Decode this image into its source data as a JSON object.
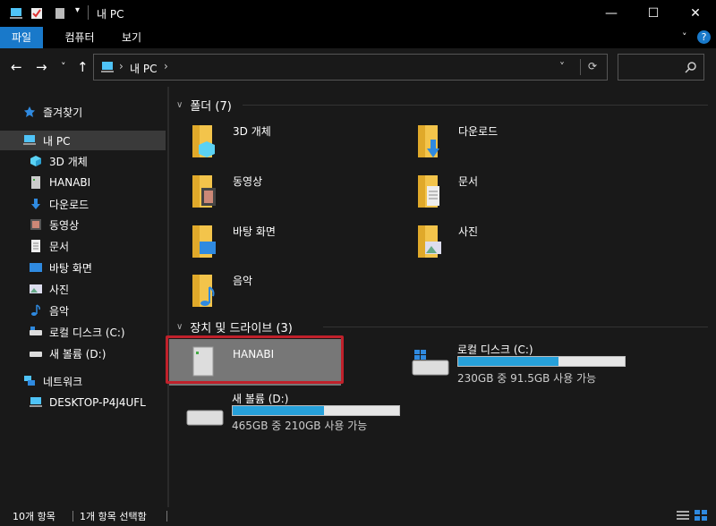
{
  "window": {
    "title": "내 PC",
    "minimize": "—",
    "maximize": "☐",
    "close": "✕"
  },
  "ribbon": {
    "tabs": [
      {
        "label": "파일",
        "active": true
      },
      {
        "label": "컴퓨터",
        "active": false
      },
      {
        "label": "보기",
        "active": false
      }
    ]
  },
  "nav": {
    "back": "←",
    "forward": "→",
    "recent": "˅",
    "up": "↑",
    "breadcrumb": [
      "내 PC"
    ],
    "refresh": "⟳",
    "dropdown": "˅"
  },
  "sidebar": {
    "items": [
      {
        "label": "즐겨찾기",
        "icon": "star-icon"
      },
      {
        "label": "내 PC",
        "icon": "pc-icon",
        "selected": true
      },
      {
        "label": "3D 개체",
        "icon": "cube-icon"
      },
      {
        "label": "HANABI",
        "icon": "server-icon"
      },
      {
        "label": "다운로드",
        "icon": "download-icon"
      },
      {
        "label": "동영상",
        "icon": "video-icon"
      },
      {
        "label": "문서",
        "icon": "document-icon"
      },
      {
        "label": "바탕 화면",
        "icon": "desktop-icon"
      },
      {
        "label": "사진",
        "icon": "picture-icon"
      },
      {
        "label": "음악",
        "icon": "music-icon"
      },
      {
        "label": "로컬 디스크 (C:)",
        "icon": "disk-icon"
      },
      {
        "label": "새 볼륨 (D:)",
        "icon": "disk-icon"
      },
      {
        "label": "네트워크",
        "icon": "network-icon"
      },
      {
        "label": "DESKTOP-P4J4UFL",
        "icon": "computer-icon"
      }
    ]
  },
  "folders": {
    "header": "폴더 (7)",
    "items": [
      {
        "label": "3D 개체",
        "icon": "cube-icon"
      },
      {
        "label": "다운로드",
        "icon": "download-icon"
      },
      {
        "label": "동영상",
        "icon": "video-icon"
      },
      {
        "label": "문서",
        "icon": "document-icon"
      },
      {
        "label": "바탕 화면",
        "icon": "desktop-icon"
      },
      {
        "label": "사진",
        "icon": "picture-icon"
      },
      {
        "label": "음악",
        "icon": "music-icon"
      }
    ]
  },
  "drives": {
    "header": "장치 및 드라이브 (3)",
    "items": [
      {
        "label": "HANABI",
        "icon": "server-icon",
        "selected": true
      },
      {
        "label": "로컬 디스크 (C:)",
        "icon": "windows-disk-icon",
        "usage_fraction": 0.6,
        "info": "230GB 중 91.5GB 사용 가능"
      },
      {
        "label": "새 볼륨 (D:)",
        "icon": "disk-icon",
        "usage_fraction": 0.55,
        "info": "465GB 중 210GB 사용 가능"
      }
    ]
  },
  "status": {
    "count": "10개 항목",
    "selected": "1개 항목 선택함"
  },
  "colors": {
    "accent": "#1979ca",
    "folder": "#f3c44b",
    "bar_fill": "#26a0da",
    "highlight": "#c0212b"
  }
}
